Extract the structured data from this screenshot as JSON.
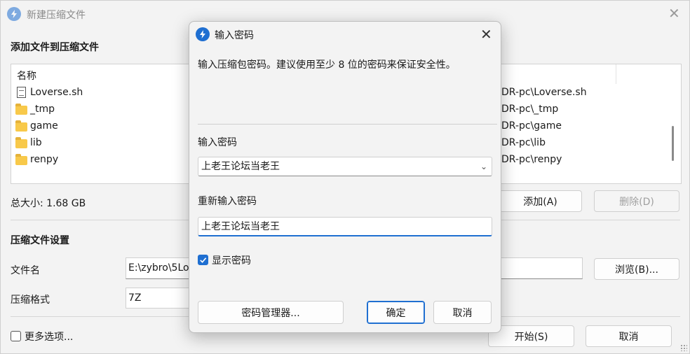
{
  "main_window": {
    "title": "新建压缩文件",
    "add_files_heading": "添加文件到压缩文件",
    "file_list": {
      "column_name": "名称",
      "items": [
        {
          "name": "Loverse.sh",
          "type": "file",
          "path": "DR-pc\\Loverse.sh"
        },
        {
          "name": "_tmp",
          "type": "folder",
          "path": "DR-pc\\_tmp"
        },
        {
          "name": "game",
          "type": "folder",
          "path": "DR-pc\\game"
        },
        {
          "name": "lib",
          "type": "folder",
          "path": "DR-pc\\lib"
        },
        {
          "name": "renpy",
          "type": "folder",
          "path": "DR-pc\\renpy"
        }
      ]
    },
    "total_size": "总大小: 1.68 GB",
    "add_button": "添加(A)",
    "delete_button": "删除(D)",
    "settings_heading": "压缩文件设置",
    "filename_label": "文件名",
    "filename_value": "E:\\zybro\\5Lo",
    "browse_button": "浏览(B)...",
    "format_label": "压缩格式",
    "format_value": "7Z",
    "more_options_label": "更多选项...",
    "start_button": "开始(S)",
    "cancel_button": "取消"
  },
  "dialog": {
    "title": "输入密码",
    "description": "输入压缩包密码。建议使用至少 8 位的密码来保证安全性。",
    "password_label": "输入密码",
    "password_value": "上老王论坛当老王",
    "reenter_label": "重新输入密码",
    "reenter_value": "上老王论坛当老王",
    "show_password_label": "显示密码",
    "show_password_checked": true,
    "manager_button": "密码管理器...",
    "ok_button": "确定",
    "cancel_button": "取消"
  },
  "colors": {
    "accent": "#1f6fd1",
    "window_bg": "#f3f3f3",
    "folder": "#f8c94a"
  },
  "icons": [
    "app-icon",
    "close-icon",
    "file-icon",
    "folder-icon",
    "chevron-down-icon",
    "checkmark-icon"
  ]
}
